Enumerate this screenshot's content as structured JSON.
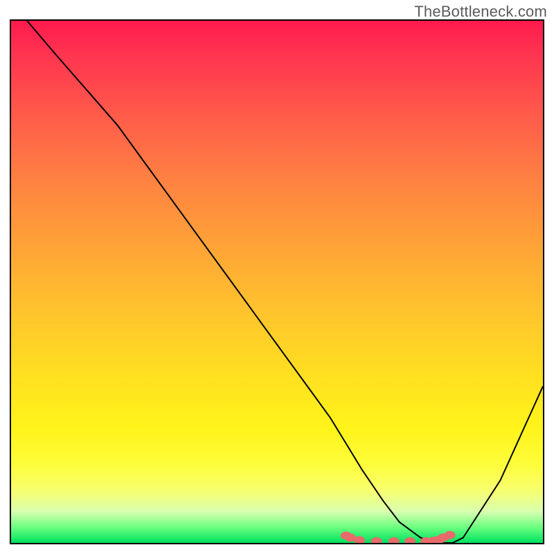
{
  "watermark": "TheBottleneck.com",
  "chart_data": {
    "type": "line",
    "title": "",
    "xlabel": "",
    "ylabel": "",
    "xlim": [
      0,
      100
    ],
    "ylim": [
      0,
      100
    ],
    "grid": false,
    "legend": false,
    "series": [
      {
        "name": "curve",
        "x": [
          3,
          8,
          14,
          20,
          25,
          30,
          35,
          40,
          45,
          50,
          55,
          60,
          63,
          66,
          70,
          73,
          77,
          80,
          83,
          85,
          92,
          100
        ],
        "values": [
          100,
          94,
          87,
          80,
          73,
          66,
          59,
          52,
          45,
          38,
          31,
          24,
          19,
          14,
          8,
          4,
          1,
          0,
          0,
          1,
          12,
          30
        ]
      }
    ],
    "markers": {
      "name": "highlight-dots",
      "color": "#e86a6a",
      "x": [
        63.0,
        63.8,
        65.5,
        68.7,
        72.0,
        75.0,
        78.0,
        79.5,
        80.5,
        81.2,
        82.5
      ],
      "values": [
        1.4,
        1.0,
        0.5,
        0.3,
        0.3,
        0.3,
        0.3,
        0.4,
        0.6,
        1.0,
        1.5
      ]
    },
    "gradient": {
      "stops": [
        {
          "pos": 0.0,
          "color": "#ff1a4d"
        },
        {
          "pos": 0.18,
          "color": "#ff5a4a"
        },
        {
          "pos": 0.42,
          "color": "#ffa038"
        },
        {
          "pos": 0.68,
          "color": "#ffe020"
        },
        {
          "pos": 0.9,
          "color": "#f8ff70"
        },
        {
          "pos": 1.0,
          "color": "#00e060"
        }
      ]
    }
  }
}
